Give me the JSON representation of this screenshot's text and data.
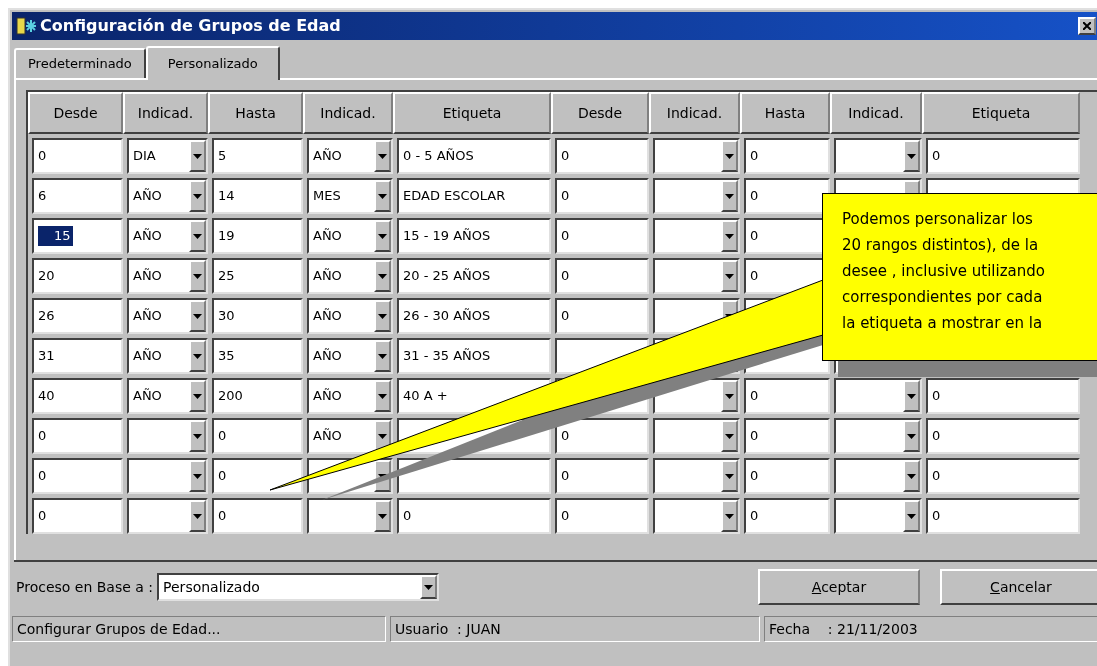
{
  "window": {
    "title": "Configuración de Grupos de Edad"
  },
  "tabs": [
    {
      "label": "Predeterminado",
      "selected": false
    },
    {
      "label": "Personalizado",
      "selected": true
    }
  ],
  "grid": {
    "columns": [
      "Desde",
      "Indicad.",
      "Hasta",
      "Indicad.",
      "Etiqueta",
      "Desde",
      "Indicad.",
      "Hasta",
      "Indicad.",
      "Etiqueta"
    ],
    "rows": [
      {
        "cells": [
          {
            "kind": "text",
            "value": "0"
          },
          {
            "kind": "combo",
            "value": "DIA"
          },
          {
            "kind": "text",
            "value": "5"
          },
          {
            "kind": "combo",
            "value": "AÑO"
          },
          {
            "kind": "text",
            "value": "0 - 5 AÑOS"
          },
          {
            "kind": "text",
            "value": "0"
          },
          {
            "kind": "combo"
          },
          {
            "kind": "text",
            "value": "0"
          },
          {
            "kind": "combo"
          },
          {
            "kind": "text",
            "value": "0"
          }
        ]
      },
      {
        "cells": [
          {
            "kind": "text",
            "value": "6"
          },
          {
            "kind": "combo",
            "value": "AÑO"
          },
          {
            "kind": "text",
            "value": "14"
          },
          {
            "kind": "combo",
            "value": "MES"
          },
          {
            "kind": "text",
            "value": "EDAD ESCOLAR"
          },
          {
            "kind": "text",
            "value": "0"
          },
          {
            "kind": "combo"
          },
          {
            "kind": "text",
            "value": "0"
          },
          {
            "kind": "combo"
          },
          {
            "kind": "text"
          }
        ]
      },
      {
        "cells": [
          {
            "kind": "focused",
            "value": "15"
          },
          {
            "kind": "combo",
            "value": "AÑO"
          },
          {
            "kind": "text",
            "value": "19"
          },
          {
            "kind": "combo",
            "value": "AÑO"
          },
          {
            "kind": "text",
            "value": "15 - 19 AÑOS"
          },
          {
            "kind": "text",
            "value": "0"
          },
          {
            "kind": "combo"
          },
          {
            "kind": "text",
            "value": "0"
          },
          {
            "kind": "combo"
          },
          {
            "kind": "text"
          }
        ]
      },
      {
        "cells": [
          {
            "kind": "text",
            "value": "20"
          },
          {
            "kind": "combo",
            "value": "AÑO"
          },
          {
            "kind": "text",
            "value": "25"
          },
          {
            "kind": "combo",
            "value": "AÑO"
          },
          {
            "kind": "text",
            "value": "20 - 25 AÑOS"
          },
          {
            "kind": "text",
            "value": "0"
          },
          {
            "kind": "combo"
          },
          {
            "kind": "text",
            "value": "0"
          },
          {
            "kind": "combo"
          },
          {
            "kind": "text"
          }
        ]
      },
      {
        "cells": [
          {
            "kind": "text",
            "value": "26"
          },
          {
            "kind": "combo",
            "value": "AÑO"
          },
          {
            "kind": "text",
            "value": "30"
          },
          {
            "kind": "combo",
            "value": "AÑO"
          },
          {
            "kind": "text",
            "value": "26 - 30 AÑOS"
          },
          {
            "kind": "text",
            "value": "0"
          },
          {
            "kind": "combo"
          },
          {
            "kind": "text"
          },
          {
            "kind": "combo"
          },
          {
            "kind": "text"
          }
        ]
      },
      {
        "cells": [
          {
            "kind": "text",
            "value": "31"
          },
          {
            "kind": "combo",
            "value": "AÑO"
          },
          {
            "kind": "text",
            "value": "35"
          },
          {
            "kind": "combo",
            "value": "AÑO"
          },
          {
            "kind": "text",
            "value": "31 - 35 AÑOS"
          },
          {
            "kind": "text"
          },
          {
            "kind": "combo"
          },
          {
            "kind": "text"
          },
          {
            "kind": "combo"
          },
          {
            "kind": "text"
          }
        ]
      },
      {
        "cells": [
          {
            "kind": "text",
            "value": "40"
          },
          {
            "kind": "combo",
            "value": "AÑO"
          },
          {
            "kind": "text",
            "value": "200"
          },
          {
            "kind": "combo",
            "value": "AÑO"
          },
          {
            "kind": "text",
            "value": "40 A +"
          },
          {
            "kind": "text"
          },
          {
            "kind": "combo"
          },
          {
            "kind": "text",
            "value": "0"
          },
          {
            "kind": "combo"
          },
          {
            "kind": "text",
            "value": "0"
          }
        ]
      },
      {
        "cells": [
          {
            "kind": "text",
            "value": "0"
          },
          {
            "kind": "combo"
          },
          {
            "kind": "text",
            "value": "0"
          },
          {
            "kind": "combo",
            "value": "AÑO"
          },
          {
            "kind": "text"
          },
          {
            "kind": "text",
            "value": "0"
          },
          {
            "kind": "combo"
          },
          {
            "kind": "text",
            "value": "0"
          },
          {
            "kind": "combo"
          },
          {
            "kind": "text",
            "value": "0"
          }
        ]
      },
      {
        "cells": [
          {
            "kind": "text",
            "value": "0"
          },
          {
            "kind": "combo"
          },
          {
            "kind": "text",
            "value": "0"
          },
          {
            "kind": "combo"
          },
          {
            "kind": "text"
          },
          {
            "kind": "text",
            "value": "0"
          },
          {
            "kind": "combo"
          },
          {
            "kind": "text",
            "value": "0"
          },
          {
            "kind": "combo"
          },
          {
            "kind": "text",
            "value": "0"
          }
        ]
      },
      {
        "cells": [
          {
            "kind": "text",
            "value": "0"
          },
          {
            "kind": "combo"
          },
          {
            "kind": "text",
            "value": "0"
          },
          {
            "kind": "combo"
          },
          {
            "kind": "text",
            "value": "0"
          },
          {
            "kind": "text",
            "value": "0"
          },
          {
            "kind": "combo"
          },
          {
            "kind": "text",
            "value": "0"
          },
          {
            "kind": "combo"
          },
          {
            "kind": "text",
            "value": "0"
          }
        ]
      }
    ]
  },
  "callout": {
    "lines": [
      "Podemos personalizar los",
      "20 rangos distintos), de la",
      "desee , inclusive utilizando",
      "correspondientes por cada",
      "la etiqueta a mostrar en la"
    ]
  },
  "footer": {
    "label": "Proceso en Base a :",
    "process_select": {
      "value": "Personalizado"
    },
    "buttons": [
      "Aceptar",
      "Cancelar"
    ]
  },
  "status_bar": [
    "Configurar Grupos de Edad...",
    "Usuario  : JUAN",
    "Fecha    : 21/11/2003"
  ]
}
